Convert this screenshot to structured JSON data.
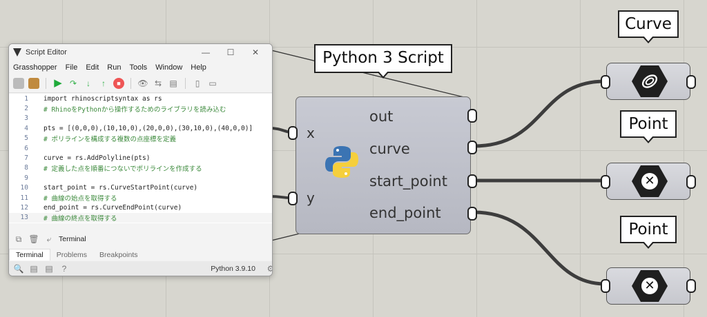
{
  "editor": {
    "title": "Script Editor",
    "window_controls": {
      "minimize": "—",
      "maximize": "☐",
      "close": "✕"
    },
    "menu": [
      "Grasshopper",
      "File",
      "Edit",
      "Run",
      "Tools",
      "Window",
      "Help"
    ],
    "code_lines": [
      {
        "num": "1",
        "text": "import rhinoscriptsyntax as rs",
        "kind": "code"
      },
      {
        "num": "2",
        "text": "# RhinoをPythonから操作するためのライブラリを読み込む",
        "kind": "comment"
      },
      {
        "num": "3",
        "text": "",
        "kind": "code"
      },
      {
        "num": "4",
        "text": "pts = [(0,0,0),(10,10,0),(20,0,0),(30,10,0),(40,0,0)]",
        "kind": "code"
      },
      {
        "num": "5",
        "text": "# ポリラインを構成する複数の点座標を定義",
        "kind": "comment"
      },
      {
        "num": "6",
        "text": "",
        "kind": "code"
      },
      {
        "num": "7",
        "text": "curve = rs.AddPolyline(pts)",
        "kind": "code"
      },
      {
        "num": "8",
        "text": "# 定義した点を順番につないでポリラインを作成する",
        "kind": "comment"
      },
      {
        "num": "9",
        "text": "",
        "kind": "code"
      },
      {
        "num": "10",
        "text": "start_point = rs.CurveStartPoint(curve)",
        "kind": "code"
      },
      {
        "num": "11",
        "text": "# 曲線の始点を取得する",
        "kind": "comment"
      },
      {
        "num": "12",
        "text": "end_point = rs.CurveEndPoint(curve)",
        "kind": "code"
      },
      {
        "num": "13",
        "text": "# 曲線の終点を取得する",
        "kind": "comment"
      }
    ],
    "terminal_label": "Terminal",
    "tabs": [
      "Terminal",
      "Problems",
      "Breakpoints"
    ],
    "active_tab": "Terminal",
    "python_version": "Python 3.9.10"
  },
  "component": {
    "callout": "Python 3 Script",
    "inputs": [
      "x",
      "y"
    ],
    "outputs": [
      "out",
      "curve",
      "start_point",
      "end_point"
    ]
  },
  "params": [
    {
      "callout": "Curve",
      "icon": "curve-param-icon"
    },
    {
      "callout": "Point",
      "icon": "point-param-icon"
    },
    {
      "callout": "Point",
      "icon": "point-param-icon"
    }
  ],
  "colors": {
    "canvas": "#d7d6cf",
    "wire": "#3d3d3d",
    "comment": "#3c8a3c",
    "run": "#1faa3a"
  }
}
